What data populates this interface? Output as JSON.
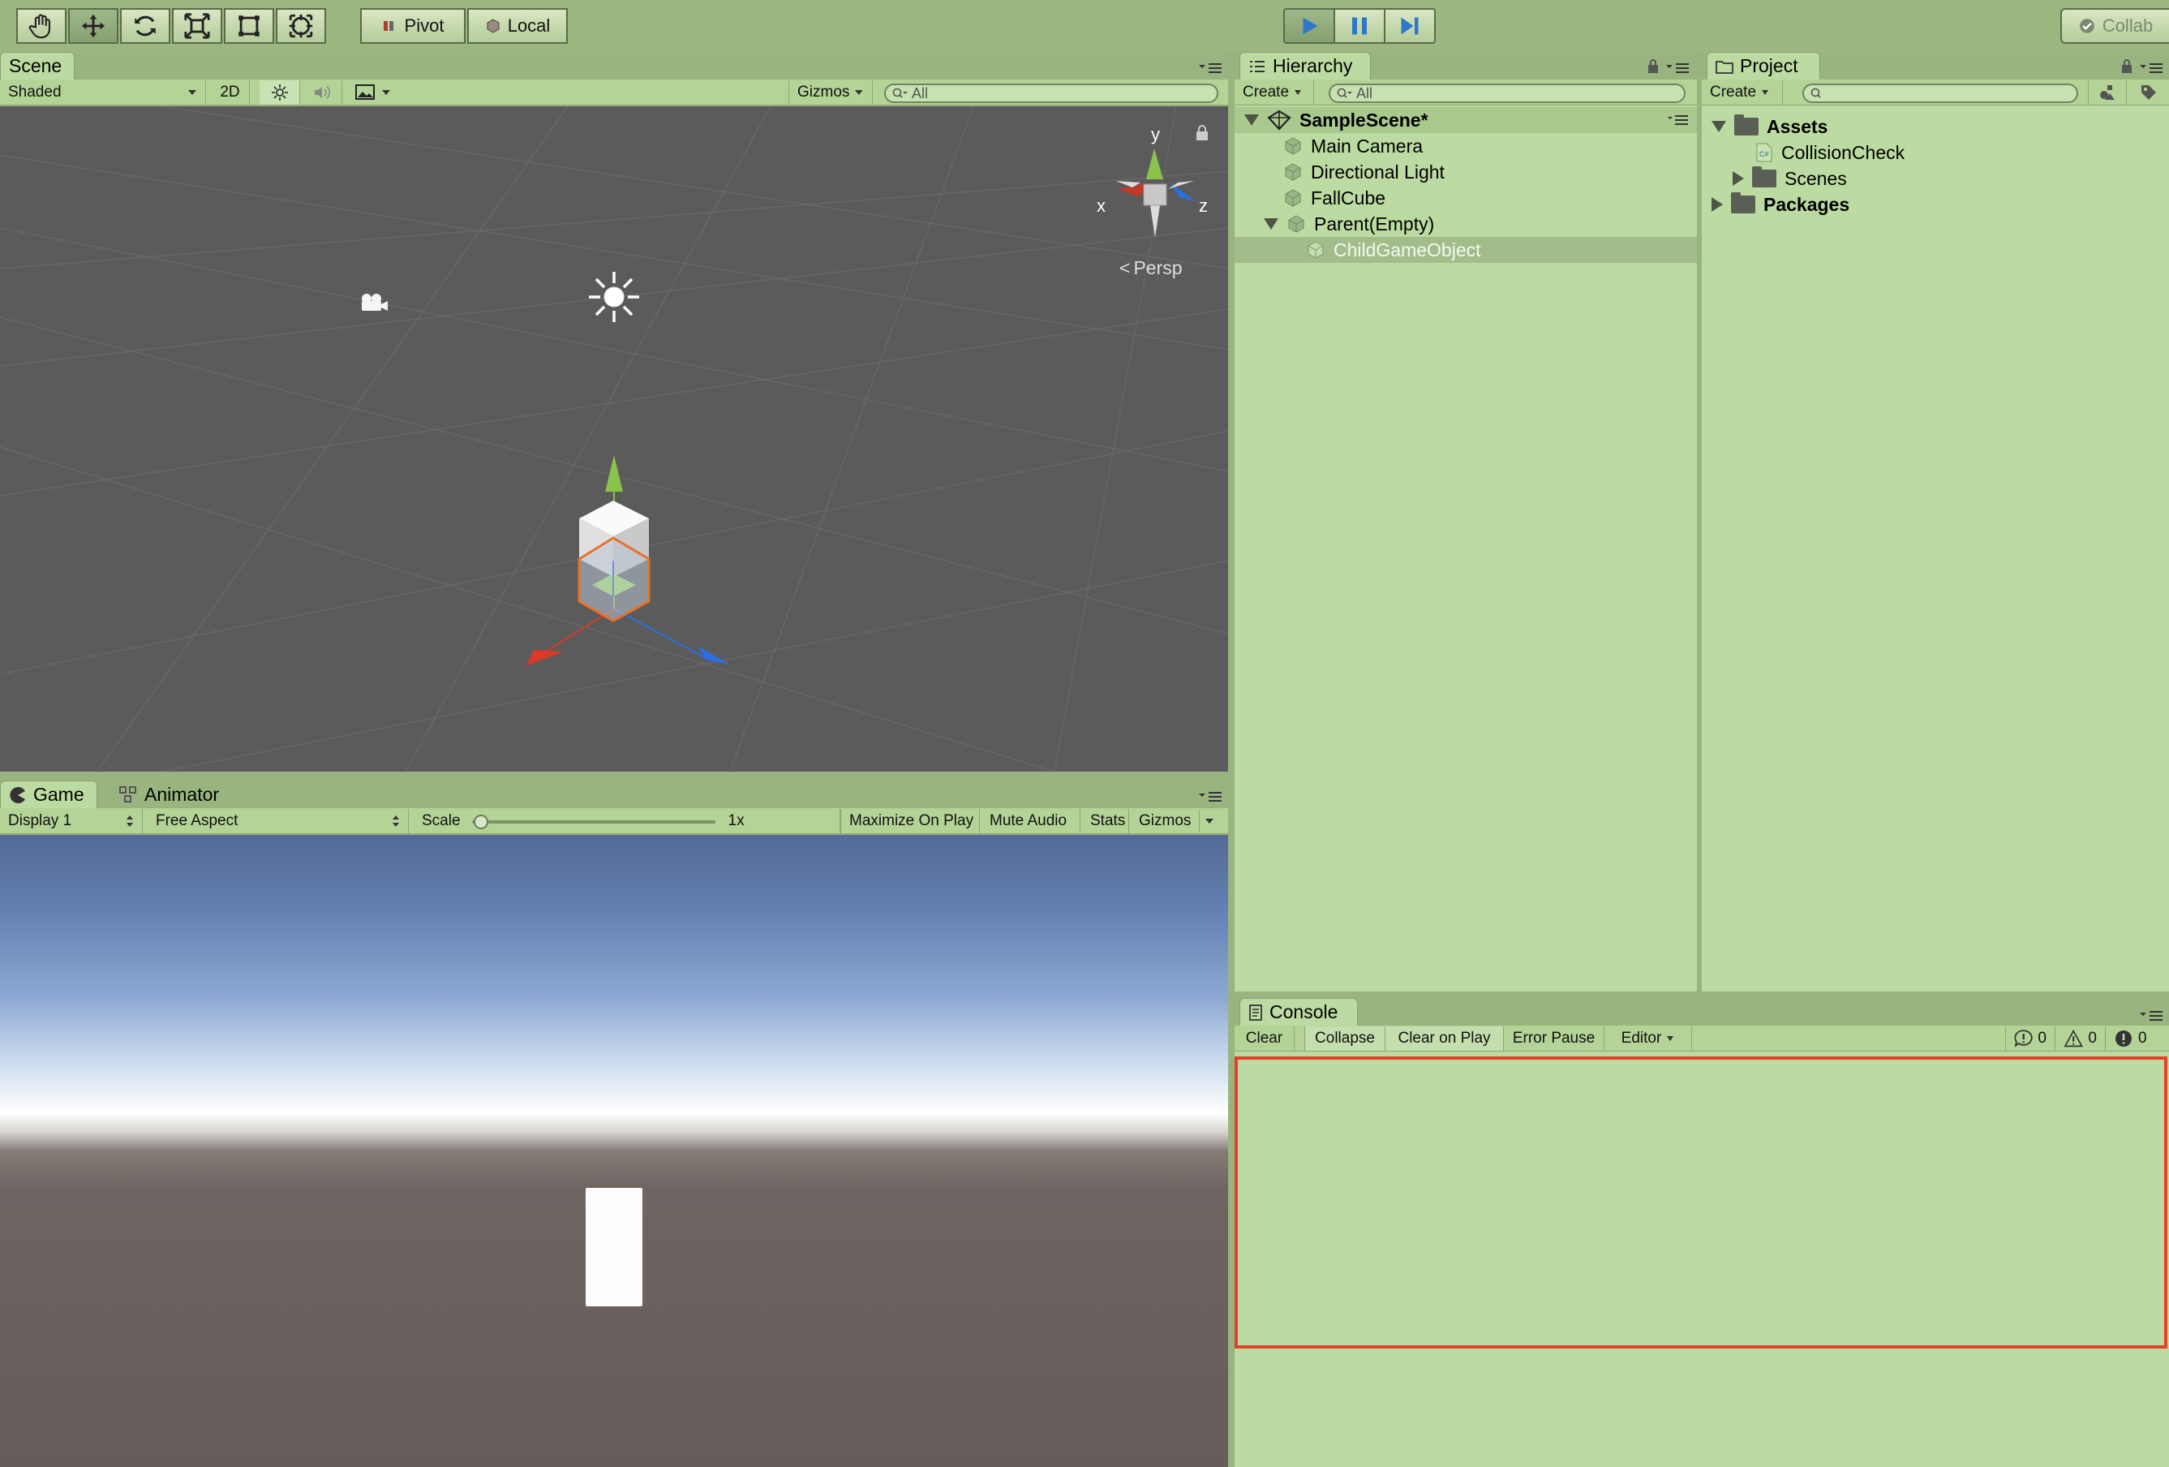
{
  "toolbar": {
    "tools": [
      {
        "icon": "hand-tool-icon"
      },
      {
        "icon": "move-tool-icon"
      },
      {
        "icon": "rotate-tool-icon"
      },
      {
        "icon": "scale-tool-icon"
      },
      {
        "icon": "rect-tool-icon"
      },
      {
        "icon": "transform-tool-icon"
      }
    ],
    "pivot_label": "Pivot",
    "local_label": "Local",
    "collab_label": "Collab"
  },
  "scene": {
    "tab_label": "Scene",
    "shading_mode": "Shaded",
    "mode_2d": "2D",
    "gizmos_label": "Gizmos",
    "search_placeholder": "All",
    "axis_y": "y",
    "axis_x": "x",
    "axis_z": "z",
    "projection_label": "Persp"
  },
  "game": {
    "tab_label": "Game",
    "animator_tab_label": "Animator",
    "display": "Display 1",
    "aspect": "Free Aspect",
    "scale_label": "Scale",
    "scale_value": "1x",
    "maximize_label": "Maximize On Play",
    "mute_label": "Mute Audio",
    "stats_label": "Stats",
    "gizmos_label": "Gizmos"
  },
  "hierarchy": {
    "tab_label": "Hierarchy",
    "create_label": "Create",
    "search_placeholder": "All",
    "scene_name": "SampleScene*",
    "items": [
      {
        "label": "Main Camera"
      },
      {
        "label": "Directional Light"
      },
      {
        "label": "FallCube"
      },
      {
        "label": "Parent(Empty)"
      },
      {
        "label": "ChildGameObject"
      }
    ]
  },
  "project": {
    "tab_label": "Project",
    "create_label": "Create",
    "assets_label": "Assets",
    "script_label": "CollisionCheck",
    "scenes_label": "Scenes",
    "packages_label": "Packages"
  },
  "console": {
    "tab_label": "Console",
    "clear_label": "Clear",
    "collapse_label": "Collapse",
    "clear_on_play_label": "Clear on Play",
    "error_pause_label": "Error Pause",
    "editor_label": "Editor",
    "info_count": "0",
    "warning_count": "0",
    "error_count": "0"
  },
  "colors": {
    "highlight_border": "#e2402b",
    "selected_row": "#a3bd8a",
    "scene_bg": "#5a5a5a",
    "panel_bg": "#bcdba2"
  }
}
